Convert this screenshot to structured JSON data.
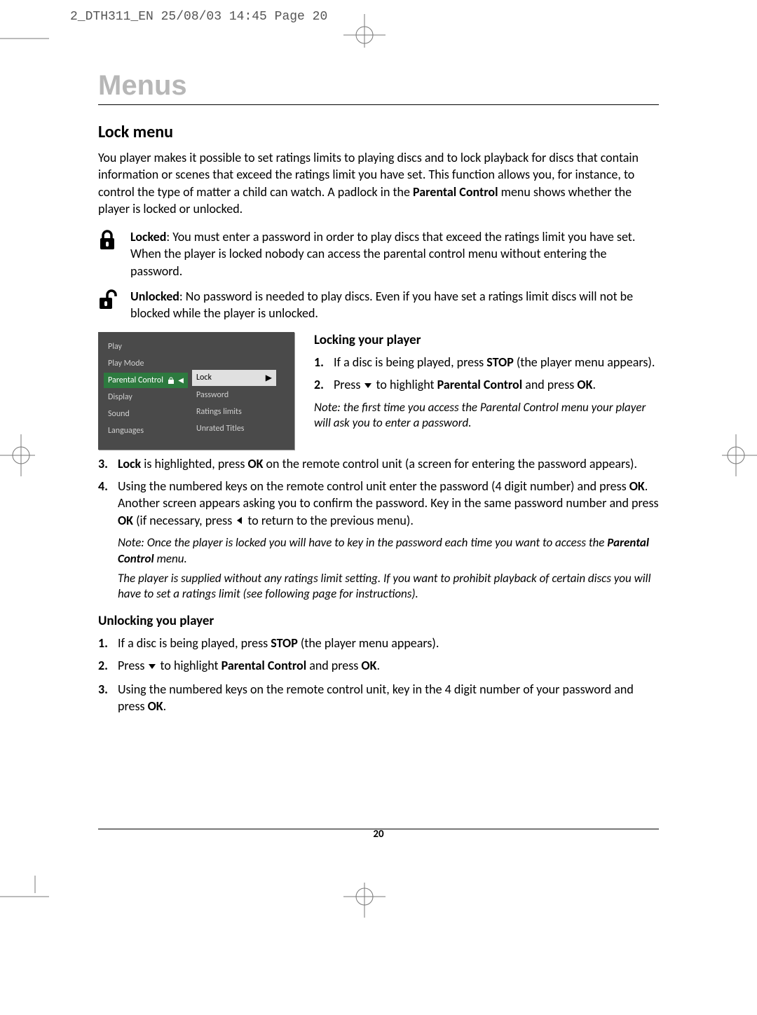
{
  "header_job": "2_DTH311_EN  25/08/03  14:45  Page 20",
  "title": "Menus",
  "section": "Lock menu",
  "intro_a": "You player makes it possible to set ratings limits to playing discs and to lock playback for discs that contain information or scenes that exceed the ratings limit you have set. This function allows you, for instance, to control the type of matter a child can watch. A padlock in the ",
  "intro_b_bold": "Parental Control",
  "intro_c": " menu shows whether the player is locked or unlocked.",
  "locked_label": "Locked",
  "locked_text": ": You must enter a password in order to play discs that exceed the ratings limit you have set. When the player is locked nobody can access the parental control menu without entering the password.",
  "unlocked_label": "Unlocked",
  "unlocked_text": ": No password is needed to play discs. Even if you have set a ratings limit discs will not be blocked while the player is unlocked.",
  "screenshot": {
    "left": [
      "Play",
      "Play Mode",
      "Parental Control",
      "Display",
      "Sound",
      "Languages"
    ],
    "right": [
      "Lock",
      "Password",
      "Ratings limits",
      "Unrated Titles"
    ]
  },
  "locking_heading": "Locking your player",
  "lock_steps": {
    "s1_a": "If a disc is being played, press ",
    "s1_b_bold": "STOP",
    "s1_c": " (the player menu appears).",
    "s2_a": "Press ",
    "s2_b": " to highlight ",
    "s2_c_bold": "Parental Control",
    "s2_d": " and press ",
    "s2_e_bold": "OK",
    "s2_f": ".",
    "note1": "Note: the first time you access the Parental Control menu your player will ask you to enter a password.",
    "s3_a_bold": "Lock",
    "s3_b": " is highlighted, press ",
    "s3_c_bold": "OK",
    "s3_d": " on the remote control unit (a screen for entering the password appears).",
    "s4_a": "Using the numbered keys on the remote control unit enter the password (4 digit number) and press ",
    "s4_b_bold": "OK",
    "s4_c": ". Another screen appears asking you to confirm the password. Key in the same password number and press ",
    "s4_d_bold": "OK",
    "s4_e": " (if necessary, press ",
    "s4_f": " to return to the previous menu)."
  },
  "note2_a": "Note: Once the player is locked you will have to key in the password each time you want to access the ",
  "note2_b_bold": "Parental Control",
  "note2_c": " menu.",
  "note3": "The player is supplied without any ratings limit setting. If you want to prohibit playback of certain discs you will have to set a ratings limit (see following page for instructions).",
  "unlocking_heading": "Unlocking you player",
  "unlock_steps": {
    "s1_a": "If a disc is being played, press ",
    "s1_b_bold": "STOP",
    "s1_c": " (the player menu appears).",
    "s2_a": "Press ",
    "s2_b": " to highlight ",
    "s2_c_bold": "Parental Control",
    "s2_d": " and press ",
    "s2_e_bold": "OK",
    "s2_f": ".",
    "s3_a": "Using the numbered keys on the remote control unit, key in the 4 digit number of your password and press ",
    "s3_b_bold": "OK",
    "s3_c": "."
  },
  "page_number": "20"
}
